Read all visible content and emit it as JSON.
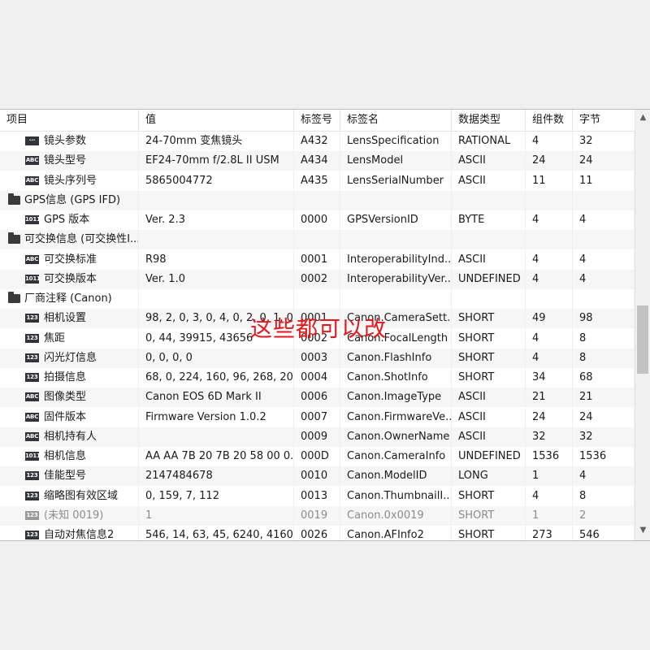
{
  "columns": [
    "项目",
    "值",
    "标签号",
    "标签名",
    "数据类型",
    "组件数",
    "字节"
  ],
  "rows": [
    {
      "kind": "item",
      "icon": "ruler",
      "icon_label": "···",
      "name": "镜头参数",
      "value": "24-70mm 变焦镜头",
      "tag": "A432",
      "tagname": "LensSpecification",
      "type": "RATIONAL",
      "count": "4",
      "bytes": "32"
    },
    {
      "kind": "item",
      "icon": "abc",
      "icon_label": "ABC",
      "name": "镜头型号",
      "value": "EF24-70mm f/2.8L II USM",
      "tag": "A434",
      "tagname": "LensModel",
      "type": "ASCII",
      "count": "24",
      "bytes": "24"
    },
    {
      "kind": "item",
      "icon": "abc",
      "icon_label": "ABC",
      "name": "镜头序列号",
      "value": "5865004772",
      "tag": "A435",
      "tagname": "LensSerialNumber",
      "type": "ASCII",
      "count": "11",
      "bytes": "11"
    },
    {
      "kind": "group",
      "name": "GPS信息 (GPS IFD)"
    },
    {
      "kind": "item",
      "icon": "bin",
      "icon_label": "1011",
      "name": "GPS 版本",
      "value": "Ver. 2.3",
      "tag": "0000",
      "tagname": "GPSVersionID",
      "type": "BYTE",
      "count": "4",
      "bytes": "4"
    },
    {
      "kind": "group",
      "name": "可交换信息 (可交换性I..."
    },
    {
      "kind": "item",
      "icon": "abc",
      "icon_label": "ABC",
      "name": "可交换标准",
      "value": "R98",
      "tag": "0001",
      "tagname": "InteroperabilityInd...",
      "type": "ASCII",
      "count": "4",
      "bytes": "4"
    },
    {
      "kind": "item",
      "icon": "bin",
      "icon_label": "1011",
      "name": "可交换版本",
      "value": "Ver. 1.0",
      "tag": "0002",
      "tagname": "InteroperabilityVer...",
      "type": "UNDEFINED",
      "count": "4",
      "bytes": "4"
    },
    {
      "kind": "group",
      "name": "厂商注释 (Canon)"
    },
    {
      "kind": "item",
      "icon": "num",
      "icon_label": "123",
      "name": "相机设置",
      "value": "98, 2, 0, 3, 0, 4, 0, 2, 0, 1, 0...",
      "tag": "0001",
      "tagname": "Canon.CameraSett...",
      "type": "SHORT",
      "count": "49",
      "bytes": "98"
    },
    {
      "kind": "item",
      "icon": "num",
      "icon_label": "123",
      "name": "焦距",
      "value": "0, 44, 39915, 43656",
      "tag": "0002",
      "tagname": "Canon.FocalLength",
      "type": "SHORT",
      "count": "4",
      "bytes": "8"
    },
    {
      "kind": "item",
      "icon": "num",
      "icon_label": "123",
      "name": "闪光灯信息",
      "value": "0, 0, 0, 0",
      "tag": "0003",
      "tagname": "Canon.FlashInfo",
      "type": "SHORT",
      "count": "4",
      "bytes": "8"
    },
    {
      "kind": "item",
      "icon": "num",
      "icon_label": "123",
      "name": "拍摄信息",
      "value": "68, 0, 224, 160, 96, 268, 20,...",
      "tag": "0004",
      "tagname": "Canon.ShotInfo",
      "type": "SHORT",
      "count": "34",
      "bytes": "68"
    },
    {
      "kind": "item",
      "icon": "abc",
      "icon_label": "ABC",
      "name": "图像类型",
      "value": "Canon EOS 6D Mark II",
      "tag": "0006",
      "tagname": "Canon.ImageType",
      "type": "ASCII",
      "count": "21",
      "bytes": "21"
    },
    {
      "kind": "item",
      "icon": "abc",
      "icon_label": "ABC",
      "name": "固件版本",
      "value": "Firmware Version 1.0.2",
      "tag": "0007",
      "tagname": "Canon.FirmwareVe...",
      "type": "ASCII",
      "count": "24",
      "bytes": "24"
    },
    {
      "kind": "item",
      "icon": "abc",
      "icon_label": "ABC",
      "name": "相机持有人",
      "value": "",
      "tag": "0009",
      "tagname": "Canon.OwnerName",
      "type": "ASCII",
      "count": "32",
      "bytes": "32"
    },
    {
      "kind": "item",
      "icon": "bin",
      "icon_label": "1011",
      "name": "相机信息",
      "value": "AA AA 7B 20 7B 20 58 00 0...",
      "tag": "000D",
      "tagname": "Canon.CameraInfo",
      "type": "UNDEFINED",
      "count": "1536",
      "bytes": "1536"
    },
    {
      "kind": "item",
      "icon": "num",
      "icon_label": "123",
      "name": "佳能型号",
      "value": "2147484678",
      "tag": "0010",
      "tagname": "Canon.ModelID",
      "type": "LONG",
      "count": "1",
      "bytes": "4"
    },
    {
      "kind": "item",
      "icon": "num",
      "icon_label": "123",
      "name": "缩略图有效区域",
      "value": "0, 159, 7, 112",
      "tag": "0013",
      "tagname": "Canon.ThumbnailI...",
      "type": "SHORT",
      "count": "4",
      "bytes": "8"
    },
    {
      "kind": "item",
      "icon": "num",
      "icon_label": "123",
      "name": "(未知 0019)",
      "value": "1",
      "tag": "0019",
      "tagname": "Canon.0x0019",
      "type": "SHORT",
      "count": "1",
      "bytes": "2",
      "dimmed": true
    },
    {
      "kind": "item",
      "icon": "num",
      "icon_label": "123",
      "name": "自动对焦信息2",
      "value": "546, 14, 63, 45, 6240, 4160...",
      "tag": "0026",
      "tagname": "Canon.AFInfo2",
      "type": "SHORT",
      "count": "273",
      "bytes": "546"
    }
  ],
  "watermark": "这些都可以改",
  "colors": {
    "watermark": "#e8151b",
    "dimmed_text": "#8c8c8c",
    "icon_bg": "#33343b"
  }
}
